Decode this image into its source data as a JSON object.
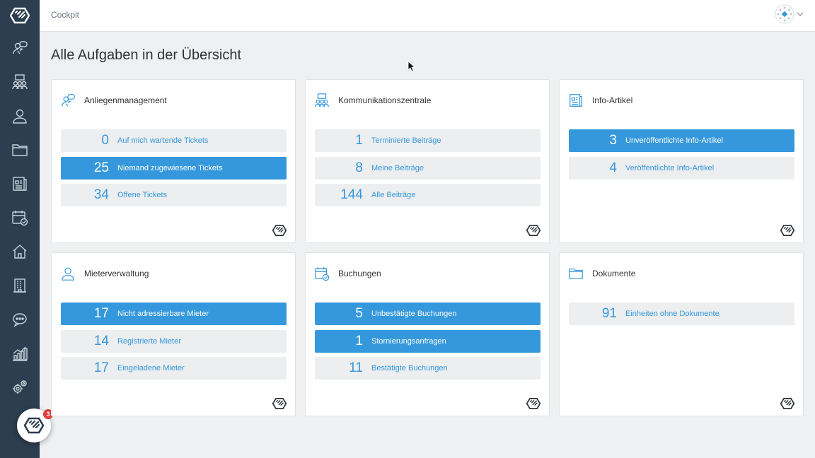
{
  "app": {
    "title": "Cockpit"
  },
  "page": {
    "heading": "Alle Aufgaben in der Übersicht"
  },
  "fab": {
    "badge": "3"
  },
  "sidebar": {
    "items": [
      {
        "name": "anliegen-icon"
      },
      {
        "name": "kommunikation-icon"
      },
      {
        "name": "person-icon"
      },
      {
        "name": "folder-icon"
      },
      {
        "name": "article-icon"
      },
      {
        "name": "calendar-icon"
      },
      {
        "name": "home-icon"
      },
      {
        "name": "building-icon"
      },
      {
        "name": "chat-icon"
      },
      {
        "name": "chart-icon"
      },
      {
        "name": "settings-icon"
      }
    ]
  },
  "colors": {
    "accent": "#3598dc",
    "sidebar": "#2c3e50",
    "row": "#eceef0",
    "badge": "#e03b3b"
  },
  "cards": [
    {
      "title": "Anliegenmanagement",
      "icon": "anliegen-icon",
      "rows": [
        {
          "count": "0",
          "label": "Auf mich wartende Tickets",
          "active": false
        },
        {
          "count": "25",
          "label": "Niemand zugewiesene Tickets",
          "active": true
        },
        {
          "count": "34",
          "label": "Offene Tickets",
          "active": false
        }
      ]
    },
    {
      "title": "Kommunikationszentrale",
      "icon": "kommunikation-icon",
      "rows": [
        {
          "count": "1",
          "label": "Terminierte Beiträge",
          "active": false
        },
        {
          "count": "8",
          "label": "Meine Beiträge",
          "active": false
        },
        {
          "count": "144",
          "label": "Alle Beiträge",
          "active": false
        }
      ]
    },
    {
      "title": "Info-Artikel",
      "icon": "article-icon",
      "rows": [
        {
          "count": "3",
          "label": "Unveröffentlichte Info-Artikel",
          "active": true
        },
        {
          "count": "4",
          "label": "Veröffentlichte Info-Artikel",
          "active": false
        }
      ]
    },
    {
      "title": "Mieterverwaltung",
      "icon": "person-icon",
      "rows": [
        {
          "count": "17",
          "label": "Nicht adressierbare Mieter",
          "active": true
        },
        {
          "count": "14",
          "label": "Registrierte Mieter",
          "active": false
        },
        {
          "count": "17",
          "label": "Eingeladene Mieter",
          "active": false
        }
      ]
    },
    {
      "title": "Buchungen",
      "icon": "calendar-icon",
      "rows": [
        {
          "count": "5",
          "label": "Unbestätigte Buchungen",
          "active": true
        },
        {
          "count": "1",
          "label": "Stornierungsanfragen",
          "active": true
        },
        {
          "count": "11",
          "label": "Bestätigte Buchungen",
          "active": false
        }
      ]
    },
    {
      "title": "Dokumente",
      "icon": "folder-icon",
      "rows": [
        {
          "count": "91",
          "label": "Einheiten ohne Dokumente",
          "active": false
        }
      ]
    }
  ]
}
